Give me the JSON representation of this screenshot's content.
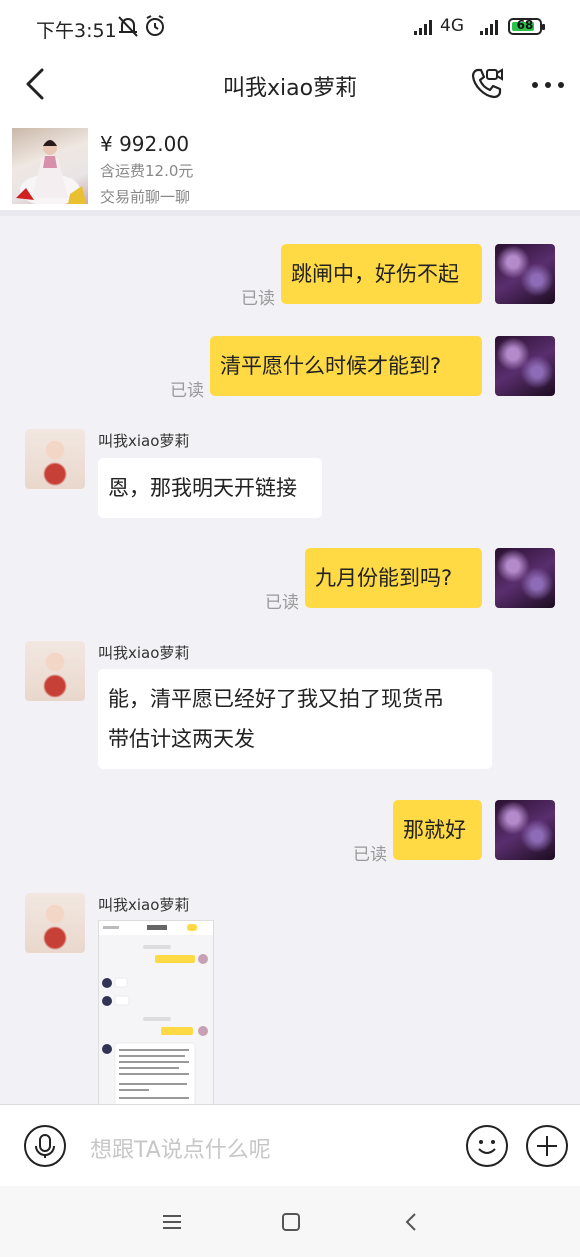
{
  "status_bar": {
    "time": "下午3:51",
    "network": "4G",
    "battery": "68",
    "battery_color": "#29c24a"
  },
  "header": {
    "title": "叫我xiao萝莉",
    "icons": [
      "back-icon",
      "video-call-icon",
      "more-icon"
    ]
  },
  "product": {
    "price": "¥ 992.00",
    "shipping": "含运费12.0元",
    "prompt": "交易前聊一聊"
  },
  "messages": [
    {
      "side": "out",
      "text": "跳闸中，好伤不起",
      "status": "已读"
    },
    {
      "side": "out",
      "text": "清平愿什么时候才能到?",
      "status": "已读"
    },
    {
      "side": "in",
      "sender": "叫我xiao萝莉",
      "text": "恩，那我明天开链接"
    },
    {
      "side": "out",
      "text": "九月份能到吗?",
      "status": "已读"
    },
    {
      "side": "in",
      "sender": "叫我xiao萝莉",
      "text_line1": "能，清平愿已经好了我又拍了现货吊",
      "text_line2": "带估计这两天发"
    },
    {
      "side": "out",
      "text": "那就好",
      "status": "已读"
    },
    {
      "side": "in",
      "sender": "叫我xiao萝莉",
      "type": "image"
    }
  ],
  "input": {
    "placeholder": "想跟TA说点什么呢"
  },
  "colors": {
    "accent": "#ffda44",
    "background": "#f1f1f6"
  }
}
